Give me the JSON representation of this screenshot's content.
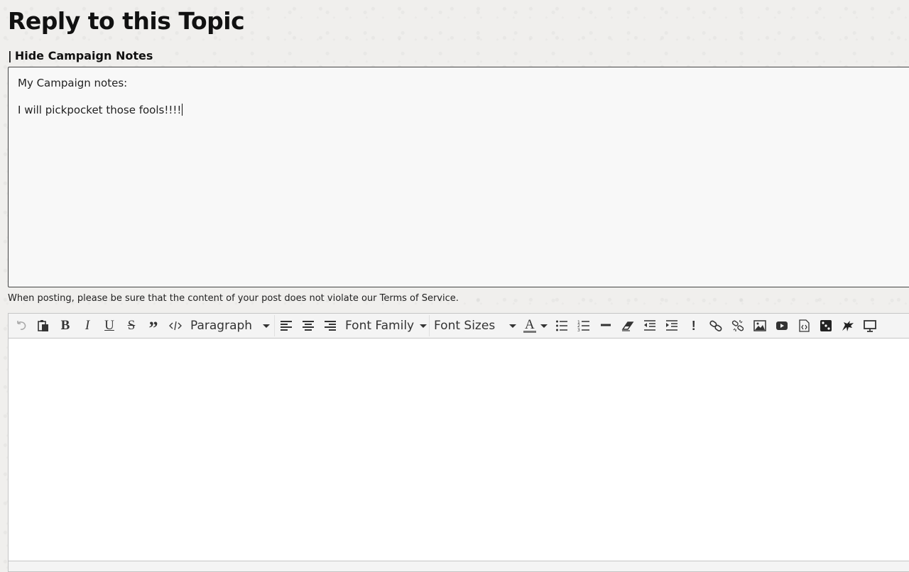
{
  "page": {
    "title": "Reply to this Topic"
  },
  "campaign_notes": {
    "separator": "|",
    "toggle_label": "Hide Campaign Notes",
    "lines": [
      "My Campaign notes:",
      "I will pickpocket those fools!!!!"
    ]
  },
  "tos_notice": "When posting, please be sure that the content of your post does not violate our Terms of Service.",
  "editor": {
    "toolbar": {
      "buttons_left": [
        "undo-icon",
        "paste-icon",
        "bold-icon",
        "italic-icon",
        "underline-icon",
        "strikethrough-icon",
        "quote-icon",
        "code-icon"
      ],
      "format_select": "Paragraph",
      "align_buttons": [
        "align-left-icon",
        "align-center-icon",
        "align-right-icon"
      ],
      "font_family_select": "Font Family",
      "font_sizes_select": "Font Sizes",
      "font_color_glyph": "A",
      "buttons_right": [
        "bullet-list-icon",
        "numbered-list-icon",
        "horizontal-rule-icon",
        "clear-format-icon",
        "outdent-icon",
        "indent-icon",
        "spoiler-icon",
        "link-icon",
        "unlink-icon",
        "image-icon",
        "video-icon",
        "embed-code-icon",
        "dice-icon",
        "dragon-icon",
        "preview-icon"
      ]
    },
    "content": ""
  }
}
